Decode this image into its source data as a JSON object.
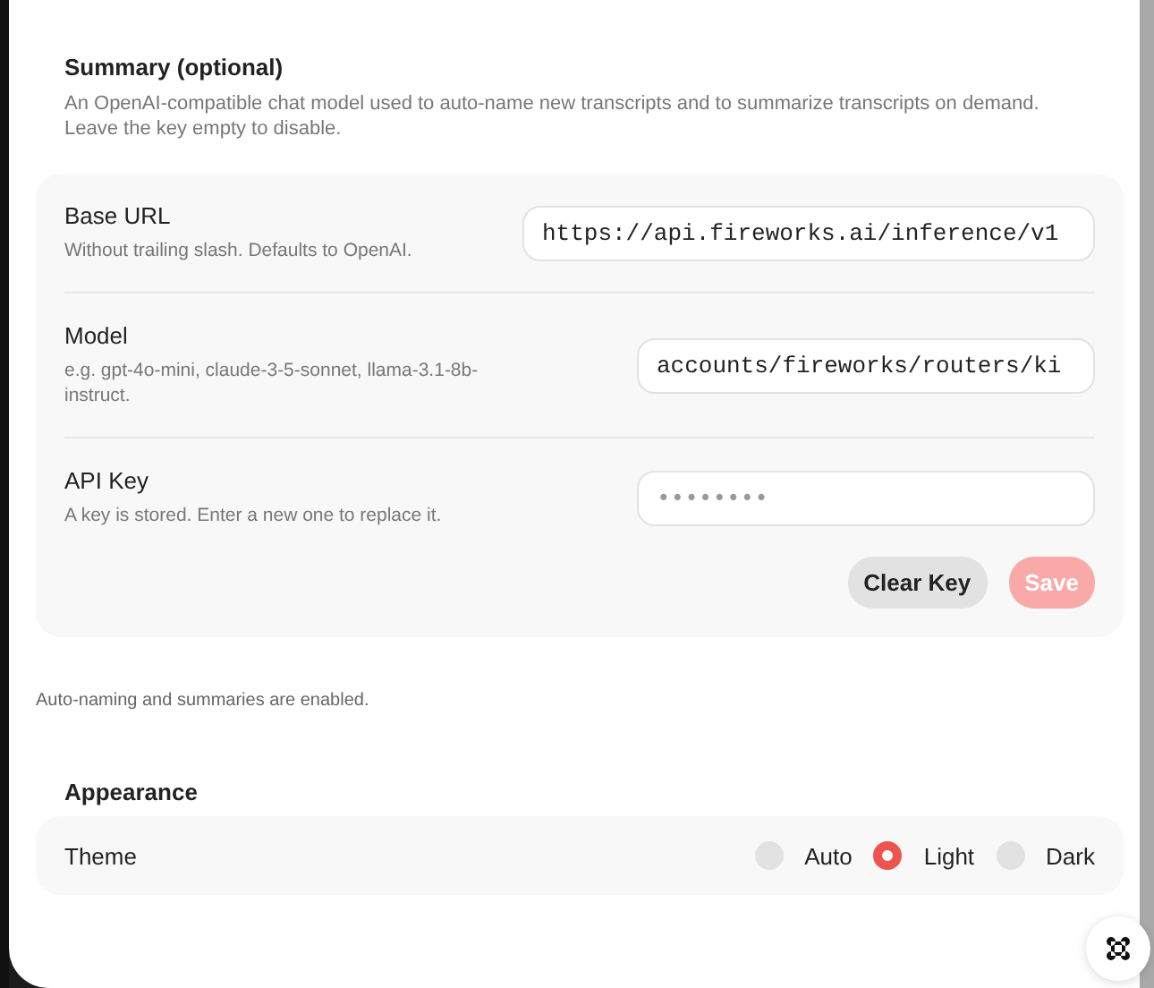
{
  "summary": {
    "title": "Summary (optional)",
    "description": "An OpenAI-compatible chat model used to auto-name new transcripts and to summarize transcripts on demand. Leave the key empty to disable.",
    "fields": [
      {
        "kind": "text",
        "label": "Base URL",
        "hint": "Without trailing slash. Defaults to OpenAI.",
        "value": "https://api.fireworks.ai/inference/v1"
      },
      {
        "kind": "text",
        "label": "Model",
        "hint": "e.g. gpt-4o-mini, claude-3-5-sonnet, llama-3.1-8b-instruct.",
        "value": "accounts/fireworks/routers/ki"
      },
      {
        "kind": "password",
        "label": "API Key",
        "hint": "A key is stored. Enter a new one to replace it.",
        "placeholder": "••••••••"
      }
    ],
    "buttons": [
      {
        "label": "Clear Key",
        "kind": "secondary",
        "disabled": false
      },
      {
        "label": "Save",
        "kind": "primary",
        "disabled": true
      }
    ],
    "status": "Auto-naming and summaries are enabled."
  },
  "appearance": {
    "title": "Appearance",
    "label": "Theme",
    "options": [
      {
        "label": "Auto",
        "selected": false
      },
      {
        "label": "Light",
        "selected": true
      },
      {
        "label": "Dark",
        "selected": false
      }
    ]
  }
}
